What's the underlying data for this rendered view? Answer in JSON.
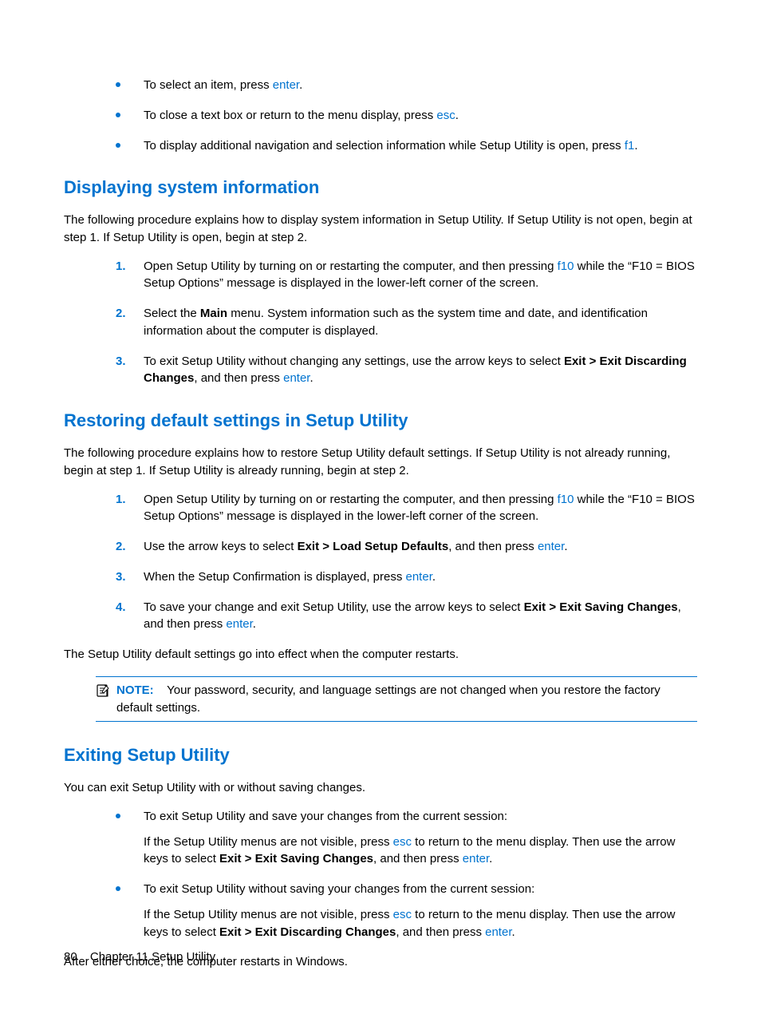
{
  "intro_bullets": [
    {
      "text_before": "To select an item, press ",
      "key1": "enter",
      "text_mid": ".",
      "key2": "",
      "text_after": ""
    },
    {
      "text_before": "To close a text box or return to the menu display, press ",
      "key1": "esc",
      "text_mid": ".",
      "key2": "",
      "text_after": ""
    },
    {
      "text_before": "To display additional navigation and selection information while Setup Utility is open, press ",
      "key1": "f1",
      "text_mid": ".",
      "key2": "",
      "text_after": ""
    }
  ],
  "sec_display": {
    "heading": "Displaying system information",
    "intro": "The following procedure explains how to display system information in Setup Utility. If Setup Utility is not open, begin at step 1. If Setup Utility is open, begin at step 2.",
    "steps": [
      {
        "parts": [
          {
            "t": "plain",
            "v": "Open Setup Utility by turning on or restarting the computer, and then pressing "
          },
          {
            "t": "key",
            "v": "f10"
          },
          {
            "t": "plain",
            "v": " while the “F10 = BIOS Setup Options” message is displayed in the lower-left corner of the screen."
          }
        ]
      },
      {
        "parts": [
          {
            "t": "plain",
            "v": "Select the "
          },
          {
            "t": "bold",
            "v": "Main"
          },
          {
            "t": "plain",
            "v": " menu. System information such as the system time and date, and identification information about the computer is displayed."
          }
        ]
      },
      {
        "parts": [
          {
            "t": "plain",
            "v": "To exit Setup Utility without changing any settings, use the arrow keys to select "
          },
          {
            "t": "bold",
            "v": "Exit > Exit Discarding Changes"
          },
          {
            "t": "plain",
            "v": ", and then press "
          },
          {
            "t": "key",
            "v": "enter"
          },
          {
            "t": "plain",
            "v": "."
          }
        ]
      }
    ]
  },
  "sec_restore": {
    "heading": "Restoring default settings in Setup Utility",
    "intro": "The following procedure explains how to restore Setup Utility default settings. If Setup Utility is not already running, begin at step 1. If Setup Utility is already running, begin at step 2.",
    "steps": [
      {
        "parts": [
          {
            "t": "plain",
            "v": "Open Setup Utility by turning on or restarting the computer, and then pressing "
          },
          {
            "t": "key",
            "v": "f10"
          },
          {
            "t": "plain",
            "v": " while the “F10 = BIOS Setup Options” message is displayed in the lower-left corner of the screen."
          }
        ]
      },
      {
        "parts": [
          {
            "t": "plain",
            "v": "Use the arrow keys to select "
          },
          {
            "t": "bold",
            "v": "Exit > Load Setup Defaults"
          },
          {
            "t": "plain",
            "v": ", and then press "
          },
          {
            "t": "key",
            "v": "enter"
          },
          {
            "t": "plain",
            "v": "."
          }
        ]
      },
      {
        "parts": [
          {
            "t": "plain",
            "v": "When the Setup Confirmation is displayed, press "
          },
          {
            "t": "key",
            "v": "enter"
          },
          {
            "t": "plain",
            "v": "."
          }
        ]
      },
      {
        "parts": [
          {
            "t": "plain",
            "v": "To save your change and exit Setup Utility, use the arrow keys to select "
          },
          {
            "t": "bold",
            "v": "Exit > Exit Saving Changes"
          },
          {
            "t": "plain",
            "v": ", and then press "
          },
          {
            "t": "key",
            "v": "enter"
          },
          {
            "t": "plain",
            "v": "."
          }
        ]
      }
    ],
    "outro": "The Setup Utility default settings go into effect when the computer restarts.",
    "note_label": "NOTE:",
    "note_text": "Your password, security, and language settings are not changed when you restore the factory default settings."
  },
  "sec_exit": {
    "heading": "Exiting Setup Utility",
    "intro": "You can exit Setup Utility with or without saving changes.",
    "bullets": [
      {
        "lead": "To exit Setup Utility and save your changes from the current session:",
        "body_parts": [
          {
            "t": "plain",
            "v": "If the Setup Utility menus are not visible, press "
          },
          {
            "t": "key",
            "v": "esc"
          },
          {
            "t": "plain",
            "v": " to return to the menu display. Then use the arrow keys to select "
          },
          {
            "t": "bold",
            "v": "Exit > Exit Saving Changes"
          },
          {
            "t": "plain",
            "v": ", and then press "
          },
          {
            "t": "key",
            "v": "enter"
          },
          {
            "t": "plain",
            "v": "."
          }
        ]
      },
      {
        "lead": "To exit Setup Utility without saving your changes from the current session:",
        "body_parts": [
          {
            "t": "plain",
            "v": "If the Setup Utility menus are not visible, press "
          },
          {
            "t": "key",
            "v": "esc"
          },
          {
            "t": "plain",
            "v": " to return to the menu display. Then use the arrow keys to select "
          },
          {
            "t": "bold",
            "v": "Exit > Exit Discarding Changes"
          },
          {
            "t": "plain",
            "v": ", and then press "
          },
          {
            "t": "key",
            "v": "enter"
          },
          {
            "t": "plain",
            "v": "."
          }
        ]
      }
    ],
    "outro": "After either choice, the computer restarts in Windows."
  },
  "footer": {
    "page_number": "80",
    "chapter": "Chapter 11   Setup Utility"
  }
}
